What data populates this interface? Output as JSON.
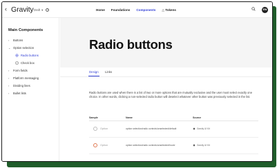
{
  "header": {
    "logo": "Gravity",
    "version": "Draft",
    "nav": [
      {
        "label": "Home",
        "active": false
      },
      {
        "label": "Foundations",
        "active": false
      },
      {
        "label": "Components",
        "active": true
      },
      {
        "label": "Tokens",
        "active": false
      }
    ],
    "avatar": "EW"
  },
  "sidebar": {
    "title": "Main Components",
    "items": [
      {
        "label": "Buttons",
        "expanded": false
      },
      {
        "label": "Option selection",
        "expanded": true
      },
      {
        "label": "Form fields",
        "expanded": false
      },
      {
        "label": "Platform messaging",
        "expanded": false
      },
      {
        "label": "Dividing lines",
        "expanded": false
      },
      {
        "label": "Bullet lists",
        "expanded": false
      }
    ],
    "subitems": [
      {
        "label": "Radio buttons",
        "active": true
      },
      {
        "label": "Check box",
        "active": false
      }
    ]
  },
  "page": {
    "title": "Radio buttons",
    "tabs": [
      {
        "label": "Design",
        "active": true
      },
      {
        "label": "Links",
        "active": false
      }
    ],
    "description": "Radio buttons are used when there is a list of two or more options that are mutually exclusive and the user must select exactly one choice. In other words, clicking a non-selected radio button will deselect whatever other button was previously selected in the list."
  },
  "table": {
    "headers": [
      "Sample",
      "Name",
      "Source"
    ],
    "rows": [
      {
        "sample": "Option",
        "name": "option selection/radio controls/unselected/default",
        "source": "Gravity UI Kit",
        "state": "default"
      },
      {
        "sample": "Option",
        "name": "option selection/radio controls/unselected/hover",
        "source": "Gravity UI Kit",
        "state": "hover"
      }
    ]
  },
  "colors": {
    "accent": "#3340d6",
    "frame_shadow": "#1f5c2a",
    "hover_ring": "#e07a54",
    "hero_bg": "#f5f5f5"
  }
}
